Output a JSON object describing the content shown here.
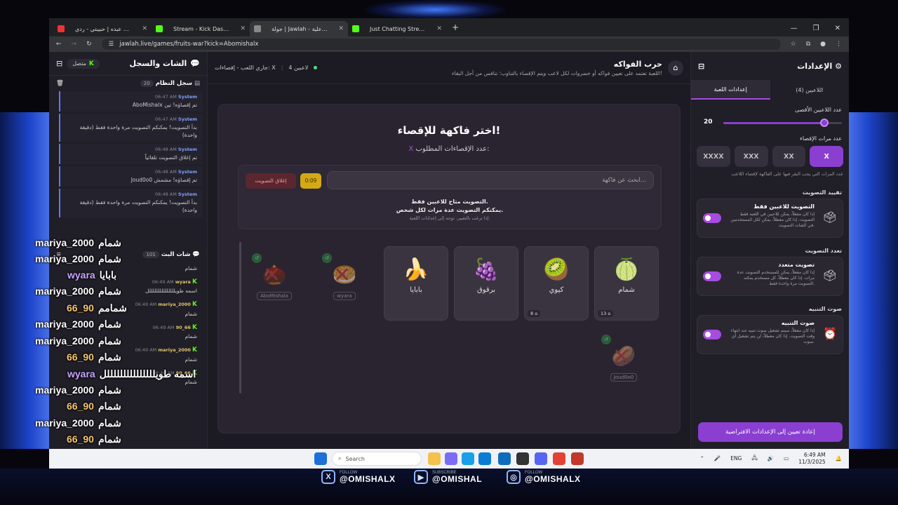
{
  "browser": {
    "tabs": [
      {
        "label": "محمد عبده | حبيبتي - ردي",
        "color": "#e33"
      },
      {
        "label": "Stream - Kick Dashboard",
        "color": "#53fc18"
      },
      {
        "label": "جولة | Jawlah - منصة الألعاب التفاعلية",
        "color": "#888"
      },
      {
        "label": "Just Chatting Streaming - Live",
        "color": "#53fc18"
      }
    ],
    "new_tab": "+",
    "url": "jawlah.live/games/fruits-war?kick=Abomishalx",
    "window_controls": [
      "—",
      "❐",
      "✕"
    ]
  },
  "chat_panel": {
    "title": "الشات والسجل",
    "status": "متصل",
    "system_log": {
      "title": "سجل النظام",
      "count": "20",
      "messages": [
        {
          "sender": "System",
          "time": "06:47 AM",
          "text": "AboMishalx تم إقصاؤه! تين"
        },
        {
          "sender": "System",
          "time": "06:47 AM",
          "text": "بدأ التصويت! يمكنكم التصويت مرة واحدة فقط (دقيقة واحدة)"
        },
        {
          "sender": "System",
          "time": "06:48 AM",
          "text": "تم إغلاق التصويت تلقائياً"
        },
        {
          "sender": "System",
          "time": "06:48 AM",
          "text": "Joud0o0 تم إقصاؤه! مشمش"
        },
        {
          "sender": "System",
          "time": "06:48 AM",
          "text": "بدأ التصويت! يمكنكم التصويت مرة واحدة فقط (دقيقة واحدة)"
        }
      ]
    },
    "live_chat": {
      "title": "شات البث",
      "count": "101",
      "messages": [
        {
          "user": "",
          "time": "",
          "text": "شمام"
        },
        {
          "user": "wyara",
          "time": "06:49 AM",
          "text": "اسمه طويلللللللللللللللل"
        },
        {
          "user": "mariya_2000",
          "time": "06:49 AM",
          "text": "شمام"
        },
        {
          "user": "90_66",
          "time": "06:49 AM",
          "text": "شمام"
        },
        {
          "user": "mariya_2000",
          "time": "06:49 AM",
          "text": "شمام"
        },
        {
          "user": "90_66",
          "time": "06:49 AM",
          "text": "شمام"
        }
      ]
    }
  },
  "game": {
    "title": "حرب الفواكه",
    "description": "اللعبة تعتمد على تعيين فواكه أو خضروات لكل لاعب ويتم الإقصاء بالتناوب؛ تنافس من أجل البقاء!",
    "status_players": "4 لاعبين",
    "status_round": "جاري اللعب - إقصاءات: X",
    "board_title": "اختر فاكهة للإقصاء!",
    "board_subtitle": "عدد الإقصاءات المطلوب:",
    "board_subtitle_value": "X",
    "search_placeholder": "ابحث عن فاكهة...",
    "timer": "0:09",
    "close_vote": "إغلاق التصويت",
    "vote_note_1": "التصويت متاح للاعبين فقط.",
    "vote_note_2": "يمكنكم التصويت عدة مرات لكل شخص.",
    "vote_note_3": "إذا ترغب بالتغيير، توجه إلى إعدادات اللعبة.",
    "fruits": [
      {
        "name": "شمام",
        "emoji": "🍈",
        "votes": "13"
      },
      {
        "name": "كيوي",
        "emoji": "🥝",
        "votes": "8"
      },
      {
        "name": "برقوق",
        "emoji": "🍇",
        "votes": ""
      },
      {
        "name": "بابايا",
        "emoji": "🍌",
        "votes": ""
      }
    ],
    "eliminated": [
      {
        "player": "wyara",
        "emoji": "🥯"
      },
      {
        "player": "AboMishalx",
        "emoji": "🌰"
      },
      {
        "player": "Joud0o0",
        "emoji": "🥔"
      }
    ]
  },
  "settings": {
    "title": "الإعدادات",
    "tab_players": "اللاعبين (4)",
    "tab_game": "إعدادات اللعبة",
    "max_players_label": "عدد اللاعبين الأقصى",
    "max_players_value": "20",
    "max_players_fraction": 0.9,
    "elim_label": "عدد مرات الإقصاء",
    "elim_options": [
      "X",
      "XX",
      "XXX",
      "XXXX"
    ],
    "elim_hint": "عدد المرات التي يجب النقر فيها على الفاكهة لإقصاء اللاعب",
    "section_restrict": "تقييد التصويت",
    "restrict_title": "التصويت للاعبين فقط",
    "restrict_desc": "إذا كان مفعلاً، يمكن للاعبين في اللعبة فقط التصويت. إذا كان معطلاً، يمكن لكل المستخدمين في الشات التصويت.",
    "section_multi": "تعدد التصويت",
    "multi_title": "تصويت متعدد",
    "multi_desc": "إذا كان مفعلاً، يمكن للمستخدم التصويت عدة مرات. إذا كان معطلاً، كل مستخدم يمكنه التصويت مرة واحدة فقط.",
    "section_sound": "صوت التنبيه",
    "sound_title": "صوت التنبيه",
    "sound_desc": "إذا كان مفعلاً، سيتم تشغيل صوت تنبيه عند انتهاء وقت التصويت. إذا كان معطلاً، لن يتم تشغيل أي صوت.",
    "reset": "إعادة تعيين إلى الإعدادات الافتراضية"
  },
  "overlay_chat": [
    {
      "user": "mariya_2000",
      "text": "شمام",
      "color": "#ffffff"
    },
    {
      "user": "mariya_2000",
      "text": "شمام",
      "color": "#ffffff"
    },
    {
      "user": "wyara",
      "text": "بابايا",
      "color": "#c9a6ff"
    },
    {
      "user": "mariya_2000",
      "text": "شمام",
      "color": "#ffffff"
    },
    {
      "user": "66_90",
      "text": "شمامم",
      "color": "#f6c66b"
    },
    {
      "user": "mariya_2000",
      "text": "شمام",
      "color": "#ffffff"
    },
    {
      "user": "mariya_2000",
      "text": "شمام",
      "color": "#ffffff"
    },
    {
      "user": "66_90",
      "text": "شمام",
      "color": "#f6c66b"
    },
    {
      "user": "wyara",
      "text": "اسمه طويلللللللللللللللل",
      "color": "#c9a6ff"
    },
    {
      "user": "mariya_2000",
      "text": "شمام",
      "color": "#ffffff"
    },
    {
      "user": "66_90",
      "text": "شمام",
      "color": "#f6c66b"
    },
    {
      "user": "mariya_2000",
      "text": "شمام",
      "color": "#ffffff"
    },
    {
      "user": "66_90",
      "text": "شمام",
      "color": "#f6c66b"
    }
  ],
  "taskbar": {
    "search": "Search",
    "lang": "ENG",
    "time": "6:49 AM",
    "date": "11/3/2025"
  },
  "socials": [
    {
      "icon": "X",
      "label": "FOLLOW",
      "handle": "@OMISHALX"
    },
    {
      "icon": "▶",
      "label": "SUBSCRIBE",
      "handle": "@OMISHAL"
    },
    {
      "icon": "◎",
      "label": "FOLLOW",
      "handle": "@OMISHALX"
    }
  ]
}
